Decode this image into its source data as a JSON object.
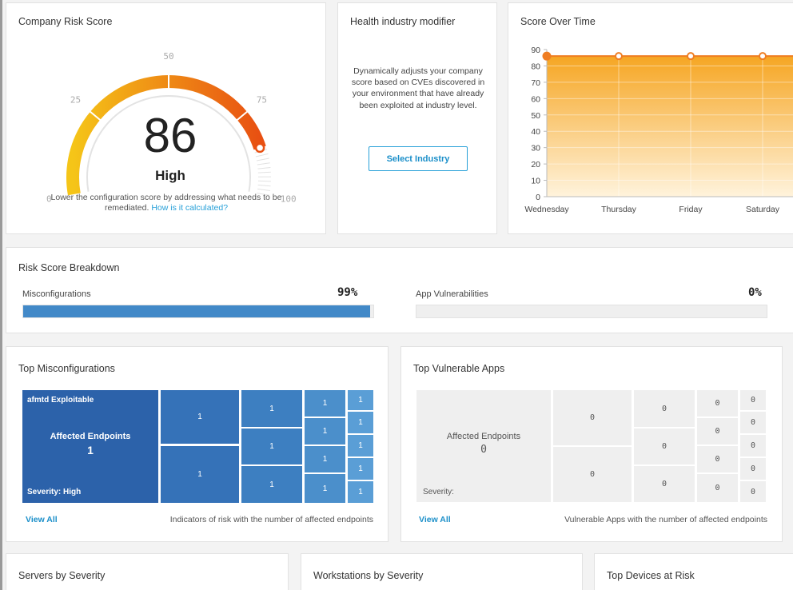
{
  "risk_score": {
    "title": "Company Risk Score",
    "score": "86",
    "level": "High",
    "ticks": [
      "0",
      "25",
      "50",
      "75",
      "100"
    ],
    "note": "Lower the configuration score by addressing what needs to be remediated.",
    "link": "How is it calculated?",
    "value_pct": 86,
    "colors": {
      "start": "#f5c518",
      "end": "#e85012",
      "track": "#e3e3e3"
    }
  },
  "health": {
    "title": "Health industry modifier",
    "description": "Dynamically adjusts your company score based on CVEs discovered in your environment that have already been exploited at industry level.",
    "button": "Select Industry"
  },
  "score_over_time": {
    "title": "Score Over Time",
    "chart_data": {
      "type": "area",
      "categories": [
        "Wednesday",
        "Thursday",
        "Friday",
        "Saturday"
      ],
      "values": [
        86,
        86,
        86,
        86
      ],
      "ylim": [
        0,
        90
      ],
      "yticks": [
        "0",
        "10",
        "20",
        "30",
        "40",
        "50",
        "60",
        "70",
        "80",
        "90"
      ],
      "grid": true,
      "colors": {
        "line": "#ef7d22",
        "fill_top": "#f6a623",
        "fill_bottom": "#fff3dc"
      }
    }
  },
  "breakdown": {
    "title": "Risk Score Breakdown",
    "misconfigurations": {
      "label": "Misconfigurations",
      "pct": "99%",
      "value": 99
    },
    "app_vulnerabilities": {
      "label": "App Vulnerabilities",
      "pct": "0%",
      "value": 0
    }
  },
  "top_misconfigurations": {
    "title": "Top Misconfigurations",
    "big": {
      "name": "afmtd Exploitable",
      "label": "Affected Endpoints",
      "count": "1",
      "severity": "Severity: High"
    },
    "cells": [
      "1",
      "1",
      "1",
      "1",
      "1",
      "1",
      "1",
      "1",
      "1",
      "1",
      "1",
      "1",
      "1",
      "1",
      "1"
    ],
    "view_all": "View All",
    "caption": "Indicators of risk with the number of affected endpoints"
  },
  "top_vulnerable_apps": {
    "title": "Top Vulnerable Apps",
    "big": {
      "label": "Affected Endpoints",
      "count": "0",
      "severity": "Severity:"
    },
    "cells": [
      "0",
      "0",
      "0",
      "0",
      "0",
      "0",
      "0",
      "0",
      "0",
      "0",
      "0",
      "0",
      "0",
      "0",
      "0"
    ],
    "view_all": "View All",
    "caption": "Vulnerable Apps with the number of affected endpoints"
  },
  "bottom": {
    "servers": "Servers by Severity",
    "workstations": "Workstations by Severity",
    "devices": "Top Devices at Risk"
  }
}
